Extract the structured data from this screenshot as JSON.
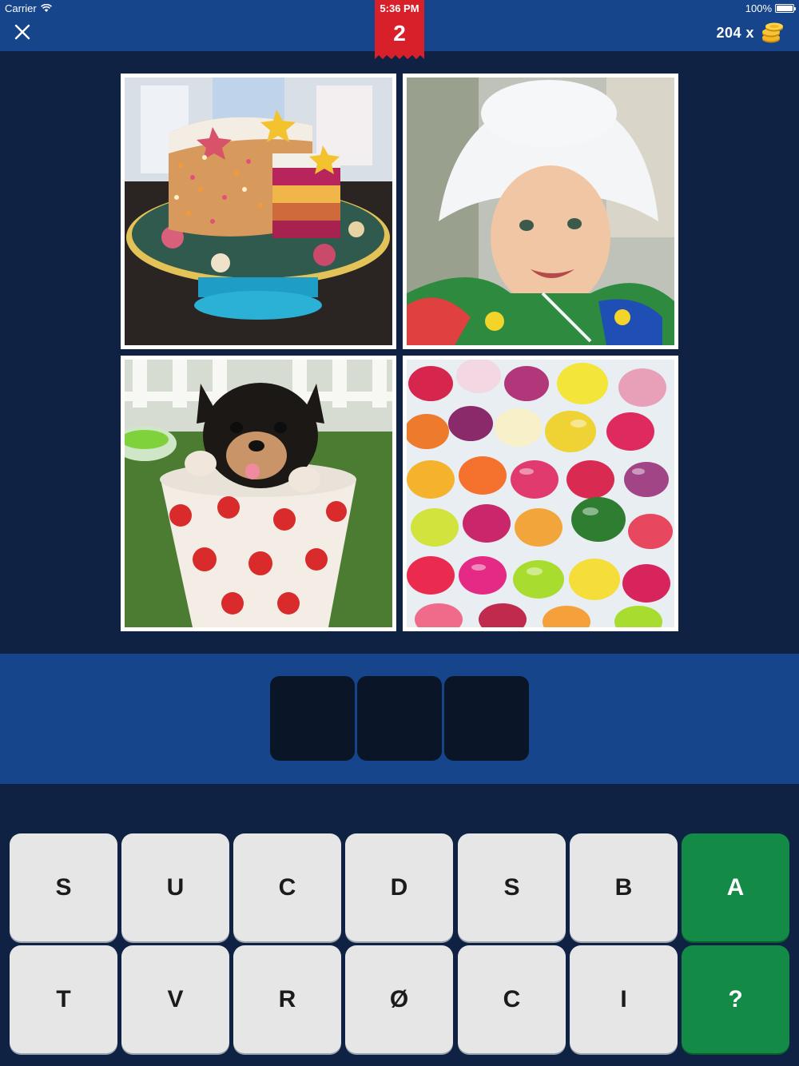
{
  "status_bar": {
    "carrier": "Carrier",
    "time": "5:36 PM",
    "battery": "100%",
    "battery_level": 1.0
  },
  "header": {
    "level": "2",
    "coins": "204 x",
    "close_icon": "close-icon",
    "coin_icon": "coin-stack-icon"
  },
  "puzzle": {
    "images": [
      {
        "name": "cake",
        "icon": "image-cake"
      },
      {
        "name": "baby",
        "icon": "image-baby"
      },
      {
        "name": "puppy",
        "icon": "image-puppy"
      },
      {
        "name": "candy",
        "icon": "image-candy"
      }
    ],
    "answer_slots": [
      "",
      "",
      ""
    ]
  },
  "keyboard": {
    "row1": [
      "S",
      "U",
      "C",
      "D",
      "S",
      "B"
    ],
    "row2": [
      "T",
      "V",
      "R",
      "Ø",
      "C",
      "I"
    ],
    "reveal_label": "A",
    "hint_label": "?"
  },
  "colors": {
    "background": "#0f2244",
    "bar": "#16458c",
    "ribbon": "#d8202b",
    "key": "#e6e6e6",
    "green_key": "#138a45",
    "slot": "#0a1628"
  }
}
